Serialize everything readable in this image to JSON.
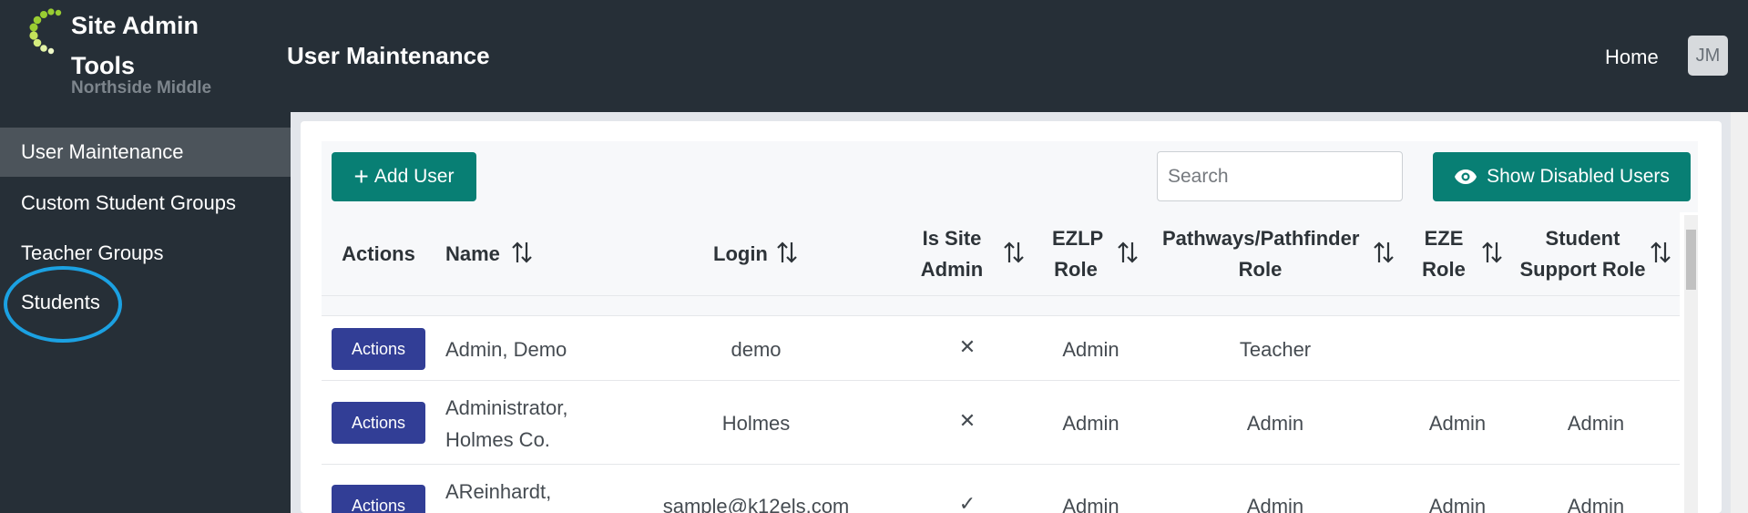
{
  "brand": {
    "title": "Site Admin Tools",
    "subtitle": "Northside Middle"
  },
  "header": {
    "page_title": "User Maintenance",
    "home_label": "Home",
    "avatar_initials": "JM"
  },
  "sidebar": {
    "items": [
      {
        "label": "User Maintenance",
        "active": true
      },
      {
        "label": "Custom Student Groups"
      },
      {
        "label": "Teacher Groups"
      },
      {
        "label": "Students"
      }
    ]
  },
  "toolbar": {
    "add_user_label": "Add User",
    "search_placeholder": "Search",
    "show_disabled_label": "Show Disabled Users"
  },
  "table": {
    "columns": [
      "Actions",
      "Name",
      "Login",
      "Is Site Admin",
      "EZLP Role",
      "Pathways/Pathfinder Role",
      "EZE Role",
      "Student Support Role"
    ],
    "action_label": "Actions",
    "rows": [
      {
        "name": "Admin, Demo",
        "login": "demo",
        "site_admin": "✕",
        "ezlp": "Admin",
        "pathways": "Teacher",
        "eze": "",
        "support": ""
      },
      {
        "name_line1": "Administrator,",
        "name_line2": "Holmes Co.",
        "login": "Holmes",
        "site_admin": "✕",
        "ezlp": "Admin",
        "pathways": "Admin",
        "eze": "Admin",
        "support": "Admin"
      },
      {
        "name_line1": "AReinhardt,",
        "login": "sample@k12els.com",
        "site_admin": "✓",
        "ezlp": "Admin",
        "pathways": "Admin",
        "eze": "Admin",
        "support": "Admin"
      }
    ]
  },
  "colors": {
    "header_bg": "#262f37",
    "active_item": "#4c545b",
    "teal": "#087f74",
    "actions_btn": "#323e96",
    "annotation": "#1ba1e2"
  }
}
